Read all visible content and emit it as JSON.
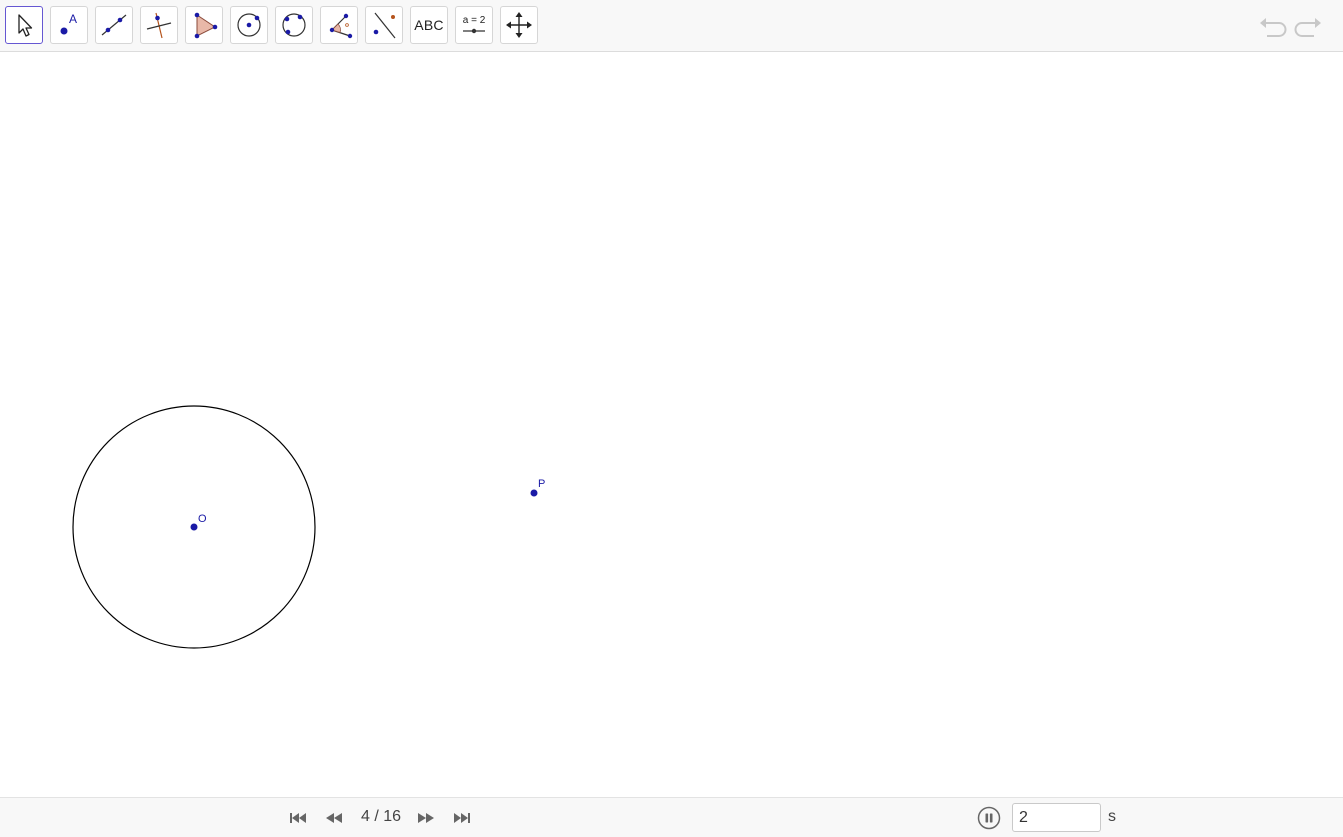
{
  "toolbar": {
    "tools": [
      {
        "name": "Move",
        "icon": "cursor-arrow-icon",
        "selected": true
      },
      {
        "name": "Point",
        "icon": "point-icon",
        "label": "A"
      },
      {
        "name": "Line",
        "icon": "line-icon"
      },
      {
        "name": "Perpendicular Line",
        "icon": "perpendicular-line-icon"
      },
      {
        "name": "Polygon",
        "icon": "polygon-icon"
      },
      {
        "name": "Circle with Center through Point",
        "icon": "circle-center-icon"
      },
      {
        "name": "Circle through 3 Points",
        "icon": "circle-three-points-icon"
      },
      {
        "name": "Angle",
        "icon": "angle-icon"
      },
      {
        "name": "Reflect about Line",
        "icon": "reflect-line-icon"
      },
      {
        "name": "Text",
        "icon": "text-icon",
        "label": "ABC"
      },
      {
        "name": "Slider",
        "icon": "slider-icon",
        "label": "a = 2"
      },
      {
        "name": "Move Graphics View",
        "icon": "move-graphics-icon"
      }
    ],
    "undo_icon": "undo-icon",
    "redo_icon": "redo-icon"
  },
  "canvas": {
    "points": [
      {
        "label": "O"
      },
      {
        "label": "P"
      }
    ],
    "colors": {
      "point": "#1a1aa6",
      "circle": "#000000",
      "label": "#1a1aa6"
    }
  },
  "playback": {
    "current_step": 4,
    "total_steps": 16,
    "step_text": "4 / 16",
    "speed_value": "2",
    "speed_unit": "s",
    "icons": [
      "first-step-icon",
      "previous-step-icon",
      "next-step-icon",
      "last-step-icon",
      "pause-icon"
    ]
  },
  "accent_color": "#6557d2"
}
